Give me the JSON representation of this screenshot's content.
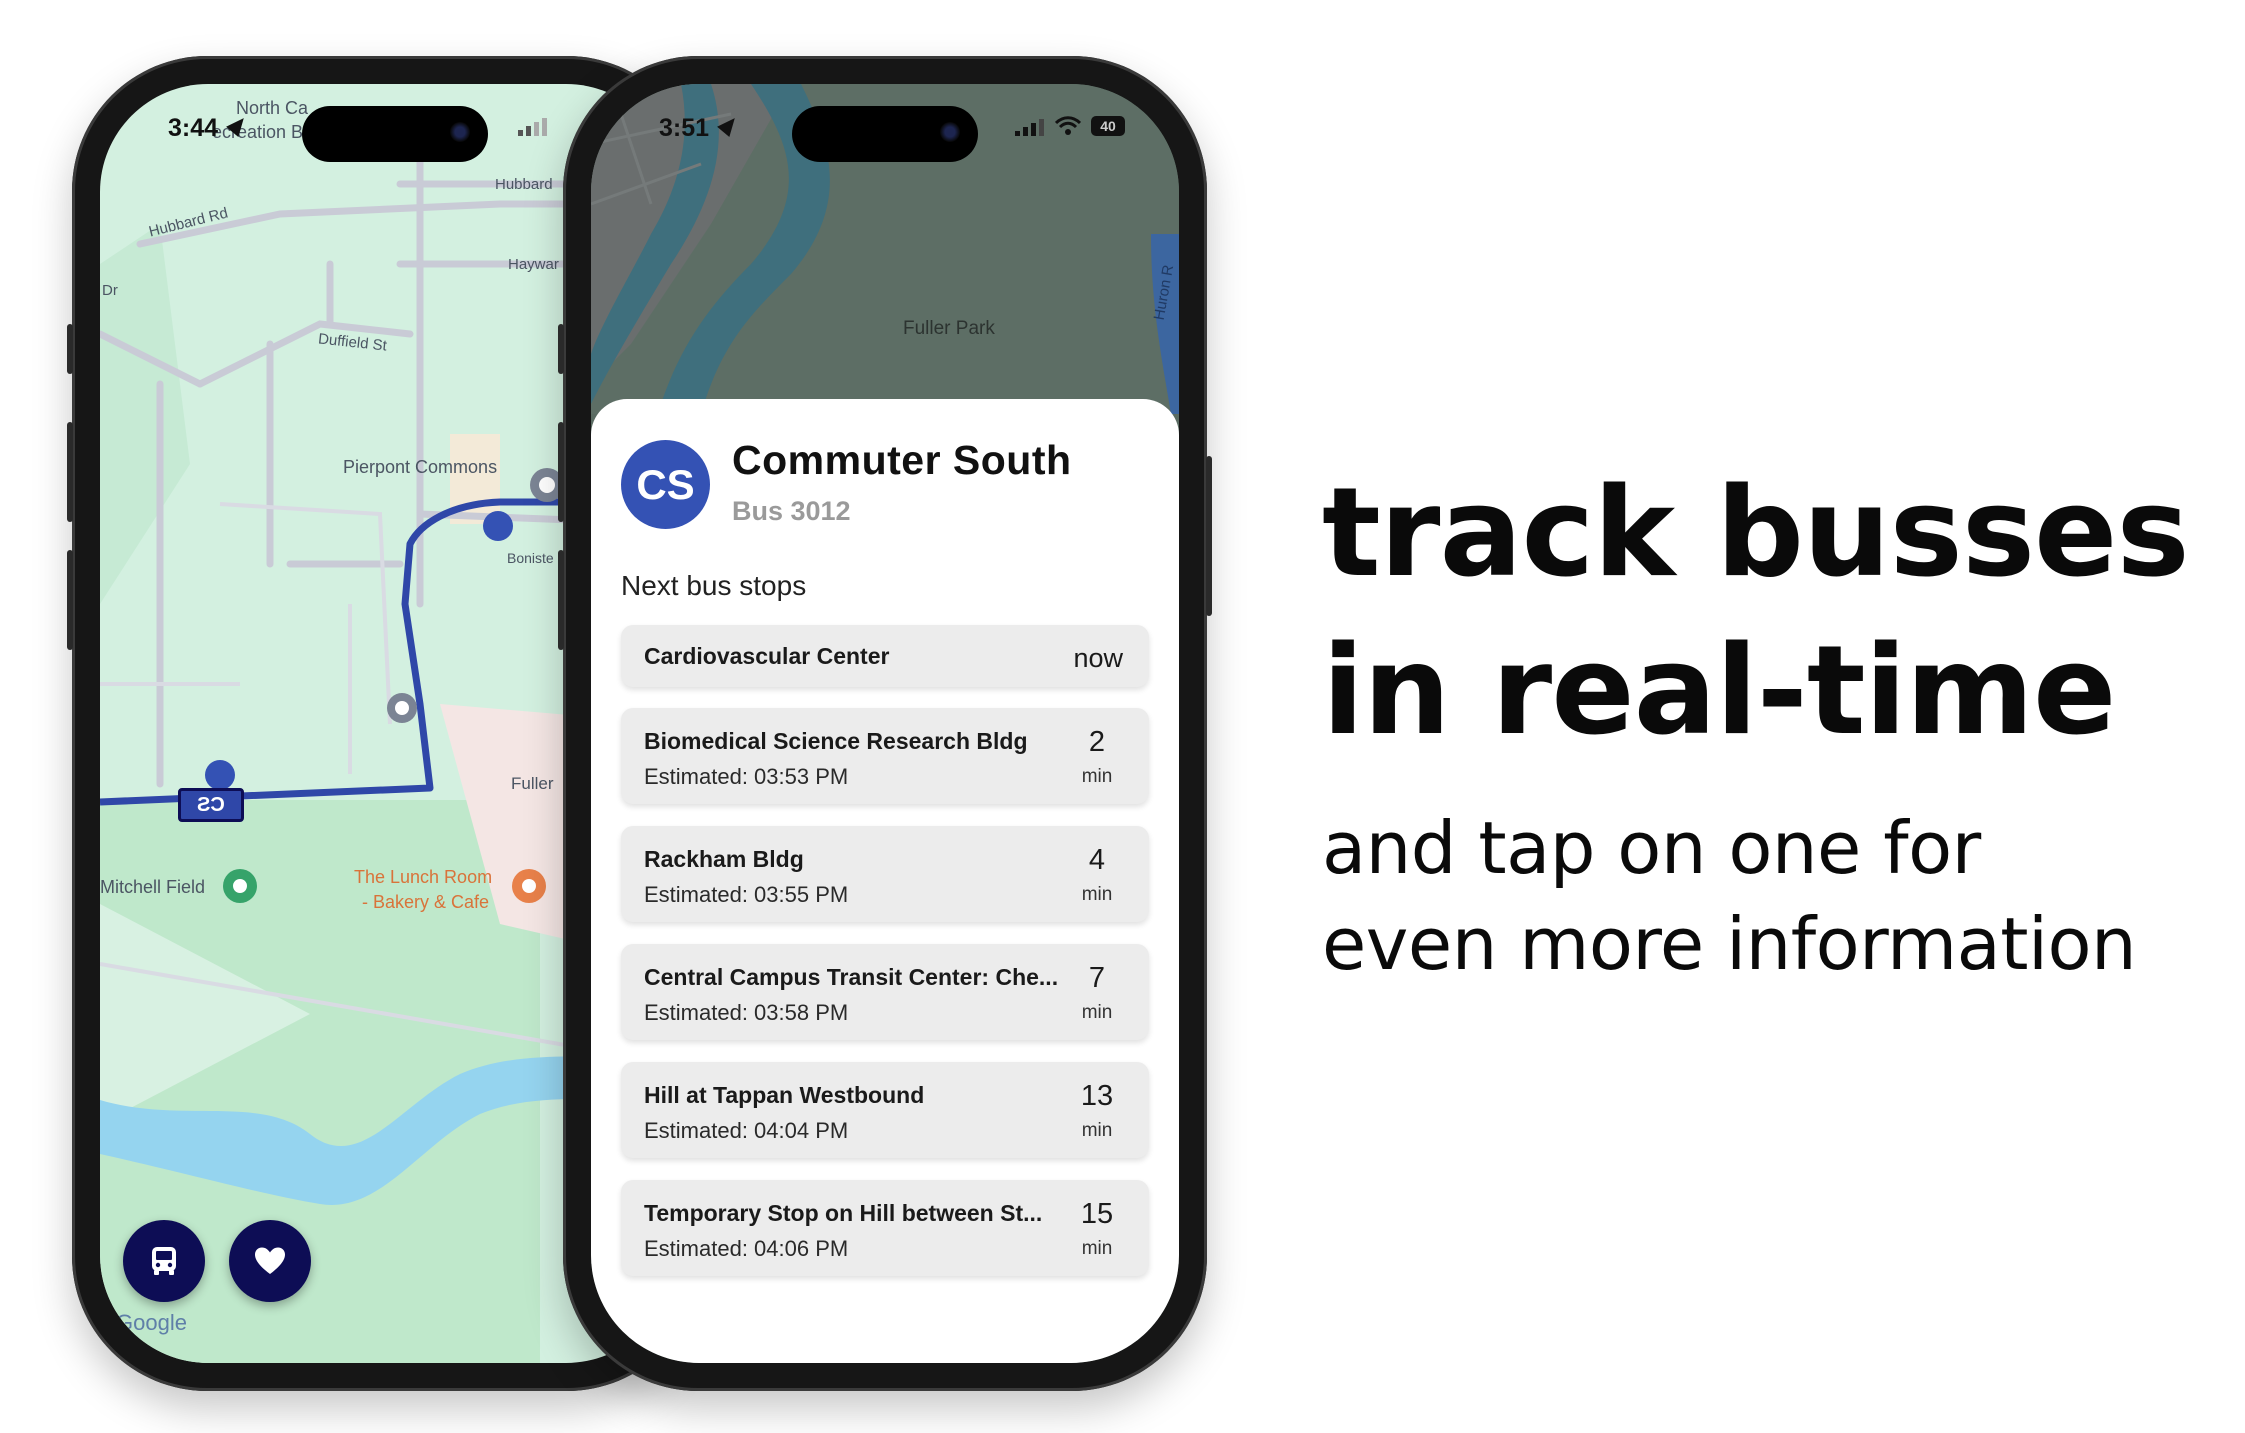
{
  "left_phone": {
    "status_time": "3:44",
    "map_labels": {
      "north_campus": "North Ca",
      "recreation": "ecreation B",
      "hubbard": "Hubbard",
      "hubbard_rd": "Hubbard Rd",
      "hayward": "Haywar",
      "dr": "Dr",
      "duffield": "Duffield St",
      "pierpont": "Pierpont Commons",
      "bonisteel": "Boniste",
      "fuller": "Fuller",
      "mitchell": "Mitchell Field",
      "lunch_room_1": "The Lunch Room",
      "lunch_room_2": "- Bakery & Cafe",
      "google": "Google"
    },
    "bus_marker_label": "CS",
    "fab_icons": [
      "bus-icon",
      "heart-icon"
    ]
  },
  "right_phone": {
    "status_time": "3:51",
    "battery": "40",
    "map_labels": {
      "fuller_park": "Fuller Park",
      "huron": "Huron R"
    },
    "route": {
      "initials": "CS",
      "name": "Commuter South",
      "bus": "Bus 3012",
      "avatar_color": "#3452b4"
    },
    "next_stops_label": "Next bus stops",
    "stops": [
      {
        "name": "Cardiovascular Center",
        "estimate": "",
        "eta": "now",
        "unit": ""
      },
      {
        "name": "Biomedical Science Research Bldg",
        "estimate": "Estimated: 03:53 PM",
        "eta": "2",
        "unit": "min"
      },
      {
        "name": "Rackham Bldg",
        "estimate": "Estimated: 03:55 PM",
        "eta": "4",
        "unit": "min"
      },
      {
        "name": "Central Campus Transit Center: Che...",
        "estimate": "Estimated: 03:58 PM",
        "eta": "7",
        "unit": "min"
      },
      {
        "name": "Hill at Tappan Westbound",
        "estimate": "Estimated: 04:04 PM",
        "eta": "13",
        "unit": "min"
      },
      {
        "name": "Temporary Stop on Hill between St...",
        "estimate": "Estimated: 04:06 PM",
        "eta": "15",
        "unit": "min"
      }
    ]
  },
  "marketing": {
    "headline_1": "track busses",
    "headline_2": "in real-time",
    "subline_1": "and tap on one for",
    "subline_2": "even more information"
  },
  "colors": {
    "route_line": "#2f47a8",
    "fab": "#0d0d55",
    "map_green": "#d3f0e0",
    "map_park": "#b9e6c6",
    "water": "#95d4ef"
  }
}
